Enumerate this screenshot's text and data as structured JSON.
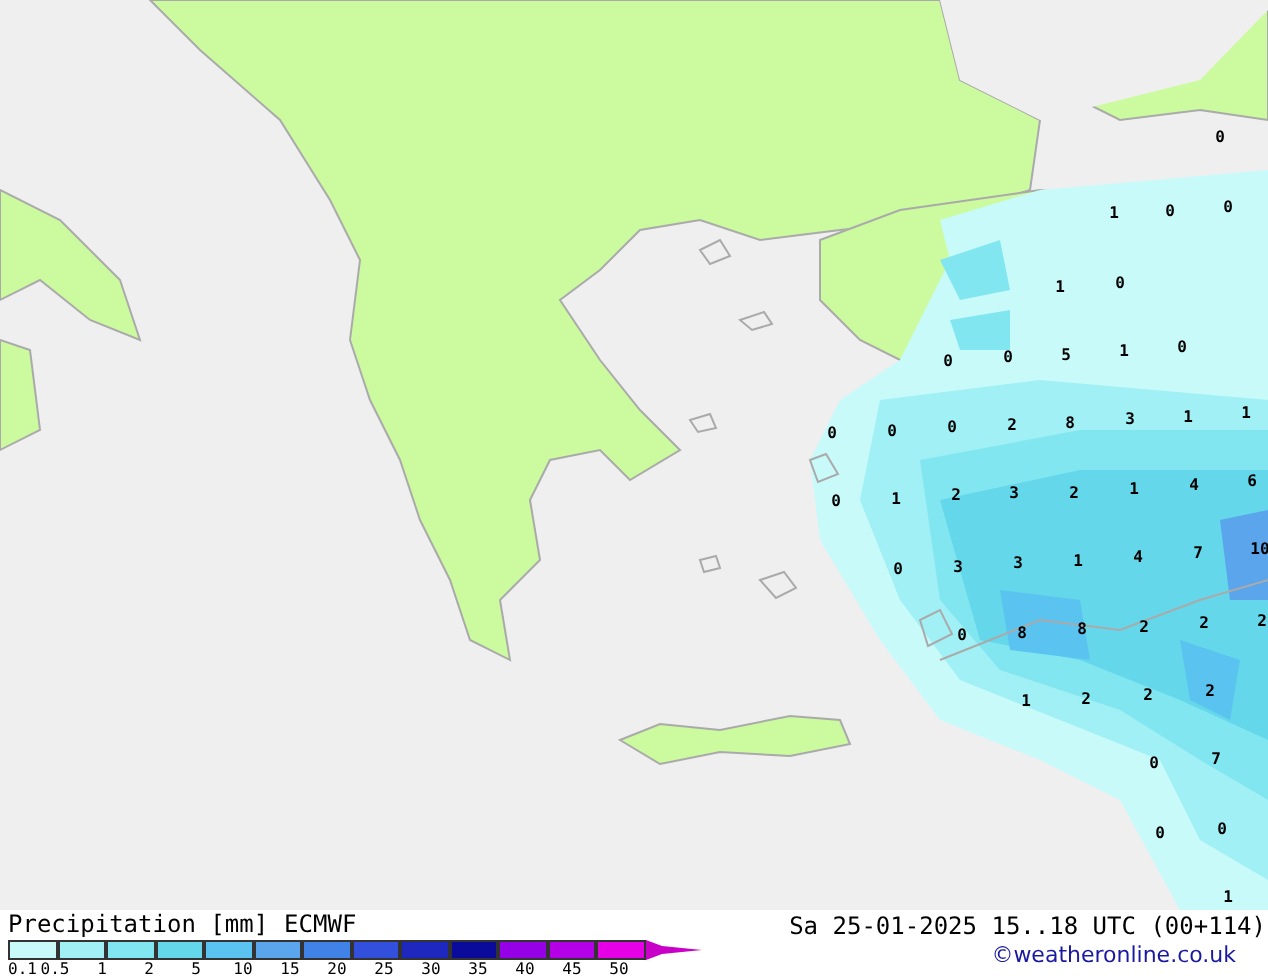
{
  "map": {
    "value_labels": [
      "0",
      "1",
      "0",
      "0",
      "1",
      "0",
      "0",
      "0",
      "5",
      "1",
      "0",
      "0",
      "0",
      "0",
      "2",
      "8",
      "3",
      "1",
      "1",
      "0",
      "1",
      "2",
      "3",
      "2",
      "1",
      "4",
      "6",
      "0",
      "3",
      "3",
      "1",
      "4",
      "7",
      "10",
      "0",
      "8",
      "8",
      "2",
      "2",
      "2",
      "1",
      "2",
      "2",
      "2",
      "0",
      "7",
      "0",
      "0",
      "1"
    ]
  },
  "legend": {
    "title": "Precipitation [mm]",
    "model": "ECMWF",
    "bins": [
      {
        "color": "#c8fafa"
      },
      {
        "color": "#a0f0f5"
      },
      {
        "color": "#82e6f0"
      },
      {
        "color": "#64d7eb"
      },
      {
        "color": "#5ac3f0"
      },
      {
        "color": "#5aa5eb"
      },
      {
        "color": "#4182e6"
      },
      {
        "color": "#3250dc"
      },
      {
        "color": "#1e28be"
      },
      {
        "color": "#0a0a9b"
      },
      {
        "color": "#9600e6"
      },
      {
        "color": "#b400e6"
      },
      {
        "color": "#e600e6"
      },
      {
        "color": "#c800c8"
      }
    ],
    "ticks": [
      "0.1",
      "0.5",
      "1",
      "2",
      "5",
      "10",
      "15",
      "20",
      "25",
      "30",
      "35",
      "40",
      "45",
      "50"
    ]
  },
  "valid_time": "Sa 25-01-2025 15..18 UTC (00+114)",
  "credit": "©weatheronline.co.uk"
}
